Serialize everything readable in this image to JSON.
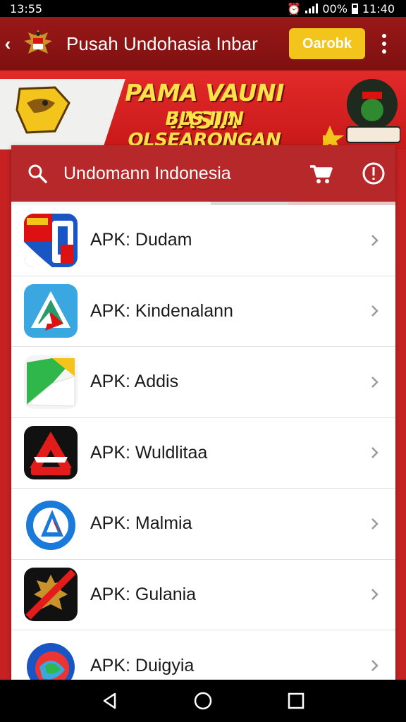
{
  "status_bar": {
    "time_left": "13:55",
    "battery_text": "00%",
    "time_right": "11:40"
  },
  "app_bar": {
    "title": "Pusah Undohasia Inbar",
    "action_pill": "Oarobk"
  },
  "banner": {
    "line1": "PAMA VAUNI IASIA",
    "line2": "BLS IIIN OLSEARONGAN"
  },
  "search": {
    "query": "Undomann Indonesia",
    "progress": 0.72
  },
  "apps": [
    {
      "label": "APK: Dudam",
      "icon": "flag-app-icon"
    },
    {
      "label": "APK: Kindenalann",
      "icon": "delta-app-icon"
    },
    {
      "label": "APK: Addis",
      "icon": "green-arrow-app-icon"
    },
    {
      "label": "APK: Wuldlitaa",
      "icon": "red-a-app-icon"
    },
    {
      "label": "APK: Malmia",
      "icon": "blue-ring-app-icon"
    },
    {
      "label": "APK: Gulania",
      "icon": "emblem-app-icon"
    },
    {
      "label": "APK: Duigyia",
      "icon": "globe-app-icon"
    }
  ],
  "colors": {
    "accent_red": "#b7282a",
    "pill_yellow": "#f3c41b",
    "banner_text": "#ffe14a"
  }
}
